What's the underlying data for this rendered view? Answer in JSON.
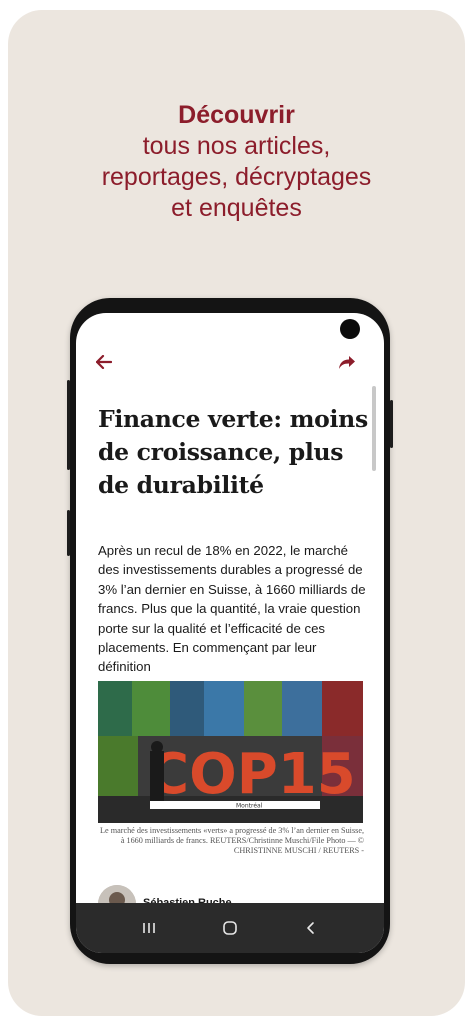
{
  "promo": {
    "headline_bold": "Découvrir",
    "line1": "tous nos articles,",
    "line2": "reportages, décryptages",
    "line3": "et enquêtes"
  },
  "toolbar": {
    "back_icon": "arrow-left-icon",
    "share_icon": "share-icon"
  },
  "article": {
    "title": "Finance verte: moins de croissance, plus de durabilité",
    "lead": "Après un recul de 18% en 2022, le marché des investissements durables a progressé de 3% l’an dernier en Suisse, à 1660 milliards de francs. Plus que la quantité, la vraie question porte sur la qualité et l’efficacité de ces placements. En commençant par leur définition",
    "photo_caption": "Le marché des investissements «verts» a progressé de 3% l’an dernier en Suisse, à 1660 milliards de francs. REUTERS/Christinne Muschi/File Photo — © CHRISTINNE MUSCHI / REUTERS -",
    "photo_text": "COP15",
    "photo_sign": "Montréal",
    "author": "Sébastien Ruche"
  },
  "colors": {
    "accent": "#8c1d2b",
    "background": "#ece6df"
  }
}
